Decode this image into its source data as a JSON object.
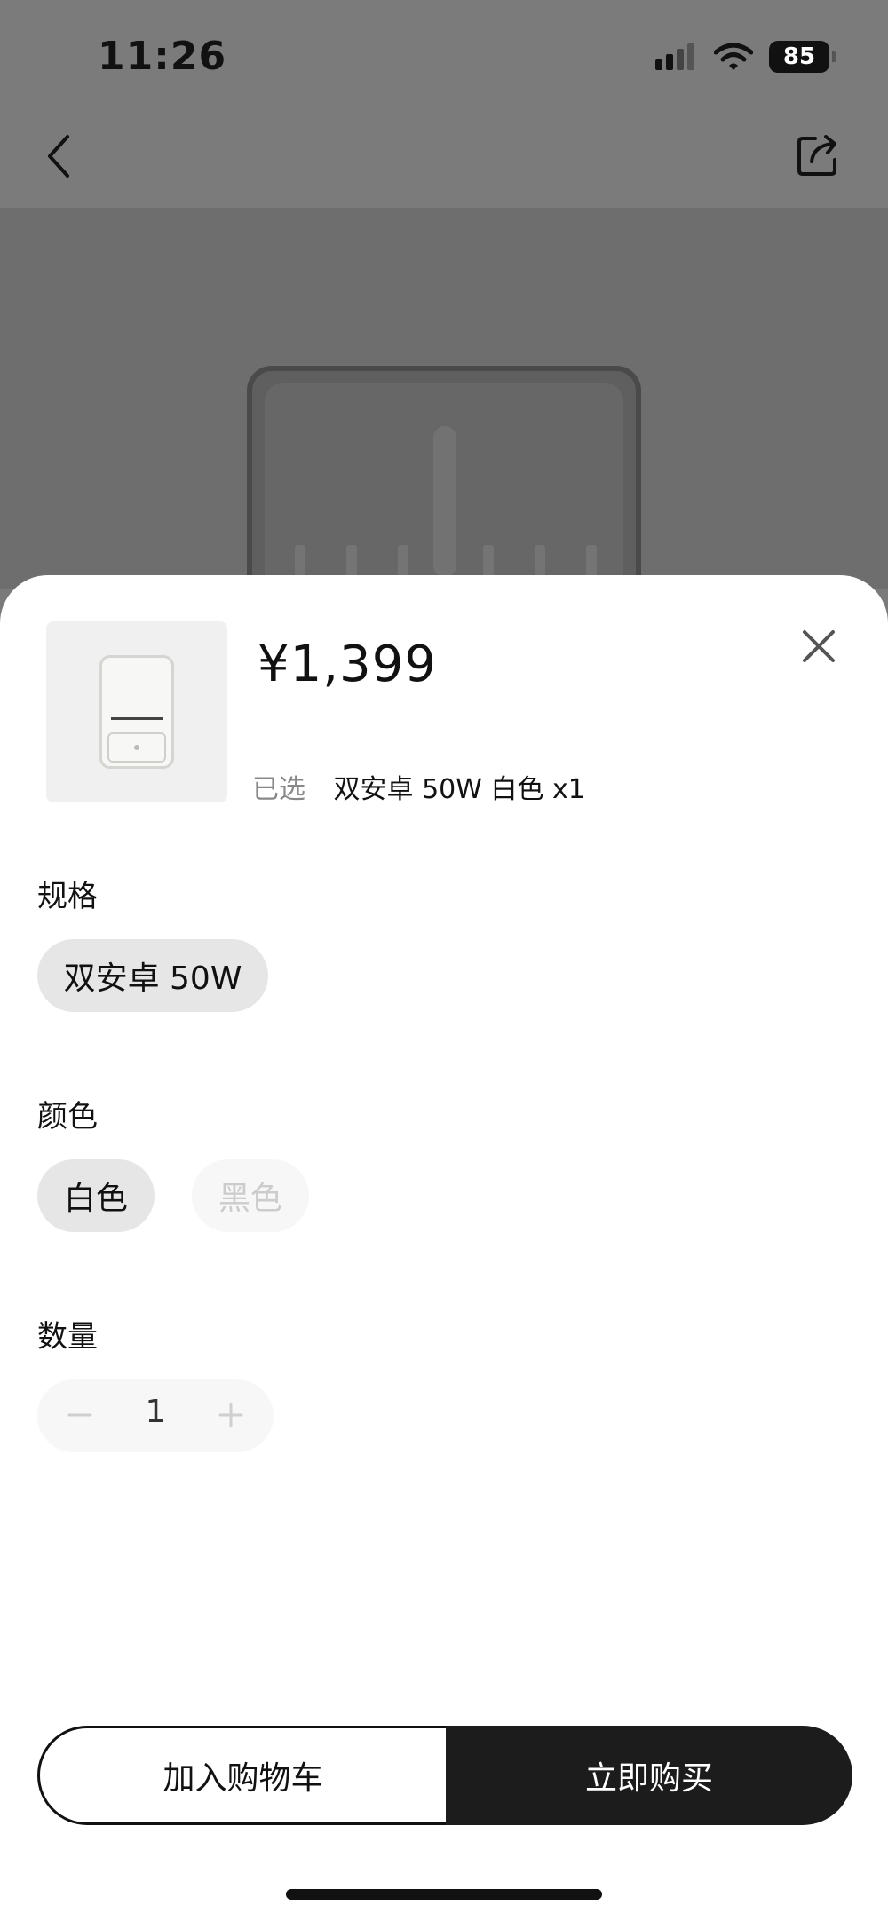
{
  "status_bar": {
    "time": "11:26",
    "battery": "85"
  },
  "product": {
    "price": "¥1,399",
    "selected_label": "已选",
    "selected_value": "双安卓 50W 白色 x1"
  },
  "spec": {
    "title": "规格",
    "options": [
      {
        "label": "双安卓 50W",
        "state": "selected"
      }
    ]
  },
  "color": {
    "title": "颜色",
    "options": [
      {
        "label": "白色",
        "state": "selected"
      },
      {
        "label": "黑色",
        "state": "disabled"
      }
    ]
  },
  "quantity": {
    "title": "数量",
    "value": "1"
  },
  "actions": {
    "add_to_cart": "加入购物车",
    "buy_now": "立即购买"
  },
  "colors": {
    "primary": "#1c1c1c",
    "chip_active": "#e6e6e6",
    "chip_disabled": "#f7f7f7"
  }
}
